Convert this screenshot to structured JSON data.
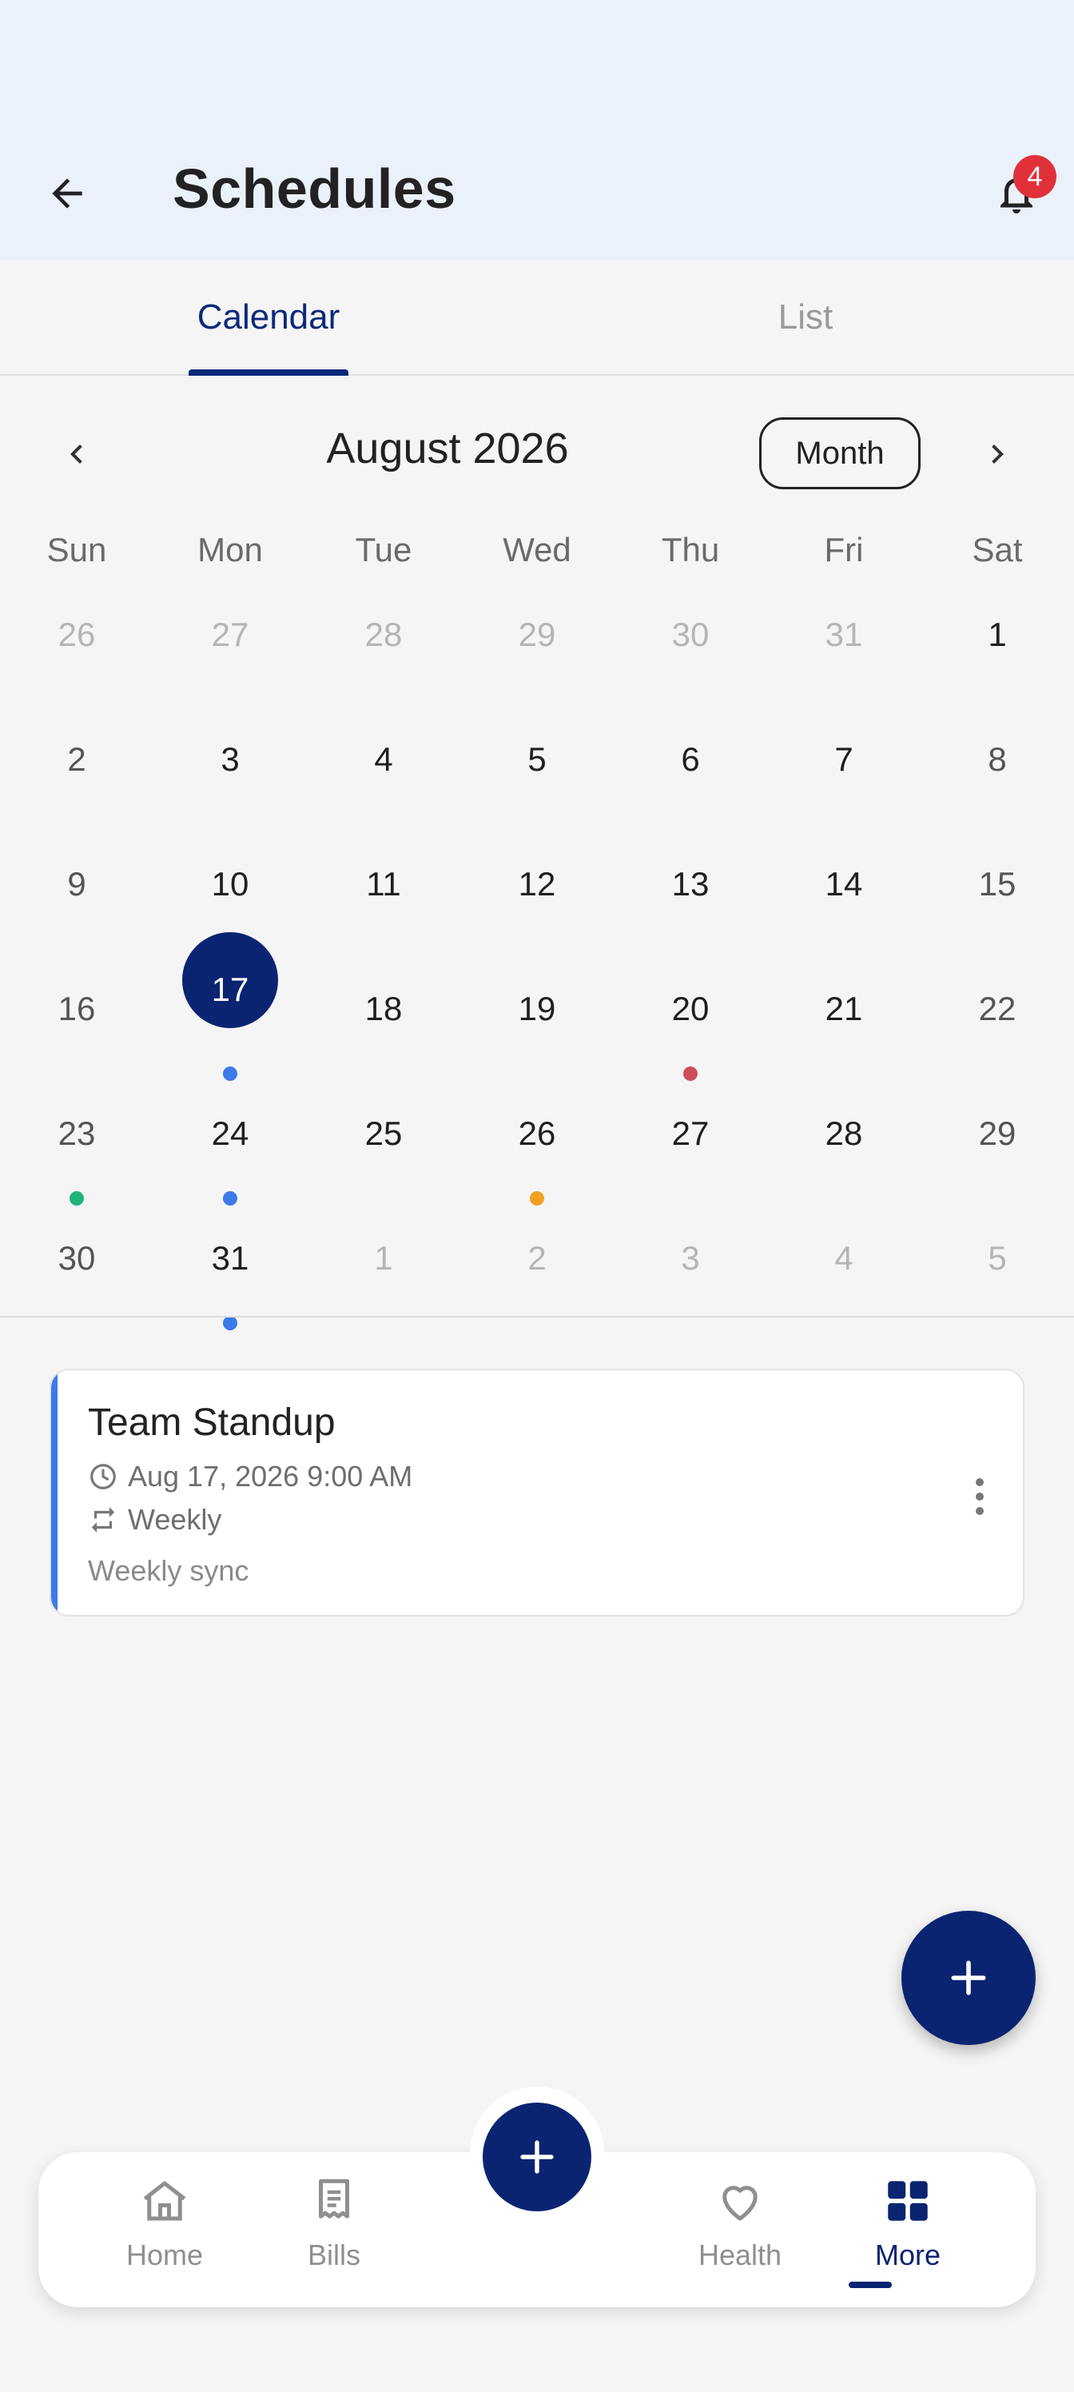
{
  "header": {
    "title": "Schedules",
    "notification_count": "4",
    "background": "#ebf1fa"
  },
  "tabs": [
    {
      "label": "Calendar",
      "active": true
    },
    {
      "label": "List",
      "active": false
    }
  ],
  "calendar": {
    "month_label": "August 2026",
    "view_mode": "Month",
    "weekdays": [
      "Sun",
      "Mon",
      "Tue",
      "Wed",
      "Thu",
      "Fri",
      "Sat"
    ],
    "selected_day": "17",
    "weeks": [
      [
        "26",
        "27",
        "28",
        "29",
        "30",
        "31",
        "1"
      ],
      [
        "2",
        "3",
        "4",
        "5",
        "6",
        "7",
        "8"
      ],
      [
        "9",
        "10",
        "11",
        "12",
        "13",
        "14",
        "15"
      ],
      [
        "16",
        "17",
        "18",
        "19",
        "20",
        "21",
        "22"
      ],
      [
        "23",
        "24",
        "25",
        "26",
        "27",
        "28",
        "29"
      ],
      [
        "30",
        "31",
        "1",
        "2",
        "3",
        "4",
        "5"
      ]
    ]
  },
  "event": {
    "title": "Team Standup",
    "datetime": "Aug 17, 2026 9:00 AM",
    "recurrence": "Weekly",
    "description": "Weekly sync",
    "accent_color": "#3b7ae8"
  },
  "bottom_nav": {
    "items": [
      {
        "label": "Home",
        "icon": "home-icon"
      },
      {
        "label": "Bills",
        "icon": "receipt-icon"
      },
      {
        "label": "Health",
        "icon": "heart-icon"
      },
      {
        "label": "More",
        "icon": "grid-icon"
      }
    ],
    "active": "More"
  },
  "colors": {
    "primary": "#0a2472",
    "dot_blue": "#3b7ae8",
    "dot_red": "#cf4d5b",
    "dot_green": "#1fb37a",
    "dot_orange": "#f2a024"
  }
}
